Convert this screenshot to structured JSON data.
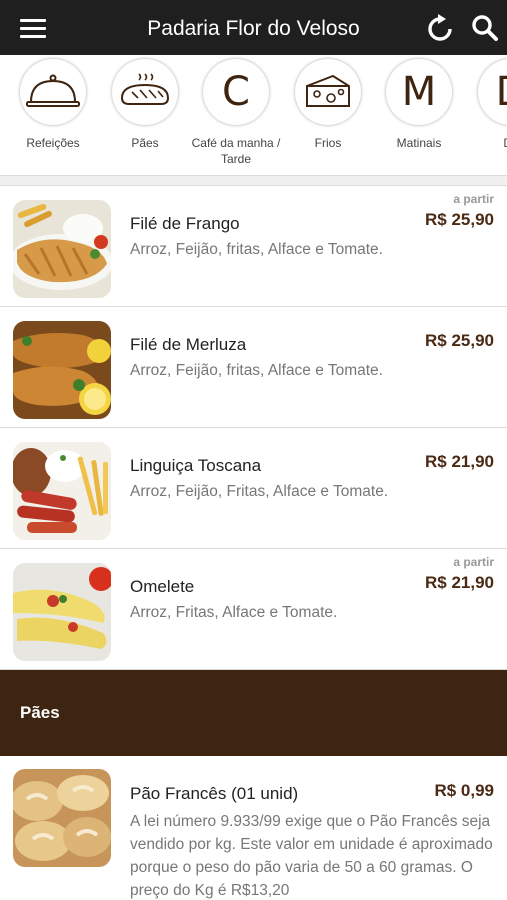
{
  "header": {
    "title": "Padaria Flor do Veloso",
    "menu_icon": "hamburger-menu-icon",
    "refresh_icon": "refresh-icon",
    "search_icon": "search-icon"
  },
  "categories": [
    {
      "label": "Refeições",
      "icon": "cloche-icon",
      "letter": ""
    },
    {
      "label": "Pães",
      "icon": "bread-icon",
      "letter": ""
    },
    {
      "label": "Café da manha / Tarde",
      "icon": "",
      "letter": "C"
    },
    {
      "label": "Frios",
      "icon": "cheese-icon",
      "letter": ""
    },
    {
      "label": "Matinais",
      "icon": "",
      "letter": "M"
    },
    {
      "label": "Do",
      "icon": "",
      "letter": "D"
    }
  ],
  "items": [
    {
      "name": "Filé de Frango",
      "description": "Arroz, Feijão, fritas,  Alface e Tomate.",
      "from_label": "a partir",
      "price": "R$ 25,90"
    },
    {
      "name": "Filé de Merluza",
      "description": "Arroz, Feijão, fritas,  Alface e Tomate.",
      "from_label": "",
      "price": "R$ 25,90"
    },
    {
      "name": "Linguiça Toscana",
      "description": "Arroz, Feijão, Fritas, Alface e Tomate.",
      "from_label": "",
      "price": "R$ 21,90"
    },
    {
      "name": "Omelete",
      "description": "Arroz, Fritas, Alface e Tomate.",
      "from_label": "a partir",
      "price": "R$ 21,90"
    }
  ],
  "section": {
    "title": "Pães"
  },
  "bread_item": {
    "name": "Pão Francês (01 unid)",
    "price": "R$ 0,99",
    "description": "A lei número 9.933/99 exige que o Pão Francês seja vendido por kg. Este valor em unidade é aproximado porque o peso do pão varia de 50 a 60 gramas. O preço do Kg é R$13,20"
  },
  "colors": {
    "topbar": "#1f1f1f",
    "brand_brown": "#3d2512",
    "price_brown": "#4a2a14"
  }
}
